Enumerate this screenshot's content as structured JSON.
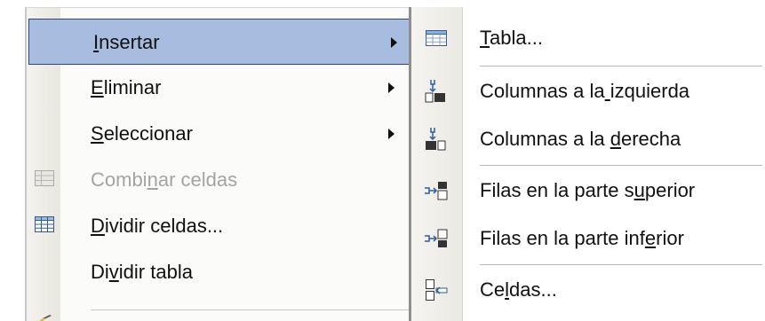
{
  "main_menu": {
    "items": [
      {
        "label": "Insertar",
        "mnemonic_index": 0,
        "submenu": true,
        "selected": true,
        "disabled": false
      },
      {
        "label": "Eliminar",
        "mnemonic_index": 0,
        "submenu": true,
        "selected": false,
        "disabled": false
      },
      {
        "label": "Seleccionar",
        "mnemonic_index": 0,
        "submenu": true,
        "selected": false,
        "disabled": false
      },
      {
        "label": "Combinar celdas",
        "mnemonic_index": 5,
        "submenu": false,
        "selected": false,
        "disabled": true,
        "icon": "merge-cells-icon"
      },
      {
        "label": "Dividir celdas...",
        "mnemonic_index": 0,
        "submenu": false,
        "selected": false,
        "disabled": false,
        "icon": "split-cells-icon"
      },
      {
        "label": "Dividir tabla",
        "mnemonic_index": 2,
        "submenu": false,
        "selected": false,
        "disabled": false
      }
    ]
  },
  "sub_menu": {
    "items": [
      {
        "label": "Tabla...",
        "mnemonic_index": 0,
        "icon": "table-icon"
      },
      {
        "label": "Columnas a la izquierda",
        "mnemonic_index": 13,
        "icon": "insert-columns-left-icon"
      },
      {
        "label": "Columnas a la derecha",
        "mnemonic_index": 14,
        "icon": "insert-columns-right-icon"
      },
      {
        "label": "Filas en la parte superior",
        "mnemonic_index": 19,
        "icon": "insert-rows-above-icon"
      },
      {
        "label": "Filas en la parte inferior",
        "mnemonic_index": 21,
        "icon": "insert-rows-below-icon"
      },
      {
        "label": "Celdas...",
        "mnemonic_index": 2,
        "icon": "insert-cells-icon"
      }
    ]
  },
  "colors": {
    "selection": "#a7bcde",
    "selection_border": "#33417b",
    "disabled_text": "#a4a4a4",
    "icon_blue": "#3a6fb0"
  }
}
